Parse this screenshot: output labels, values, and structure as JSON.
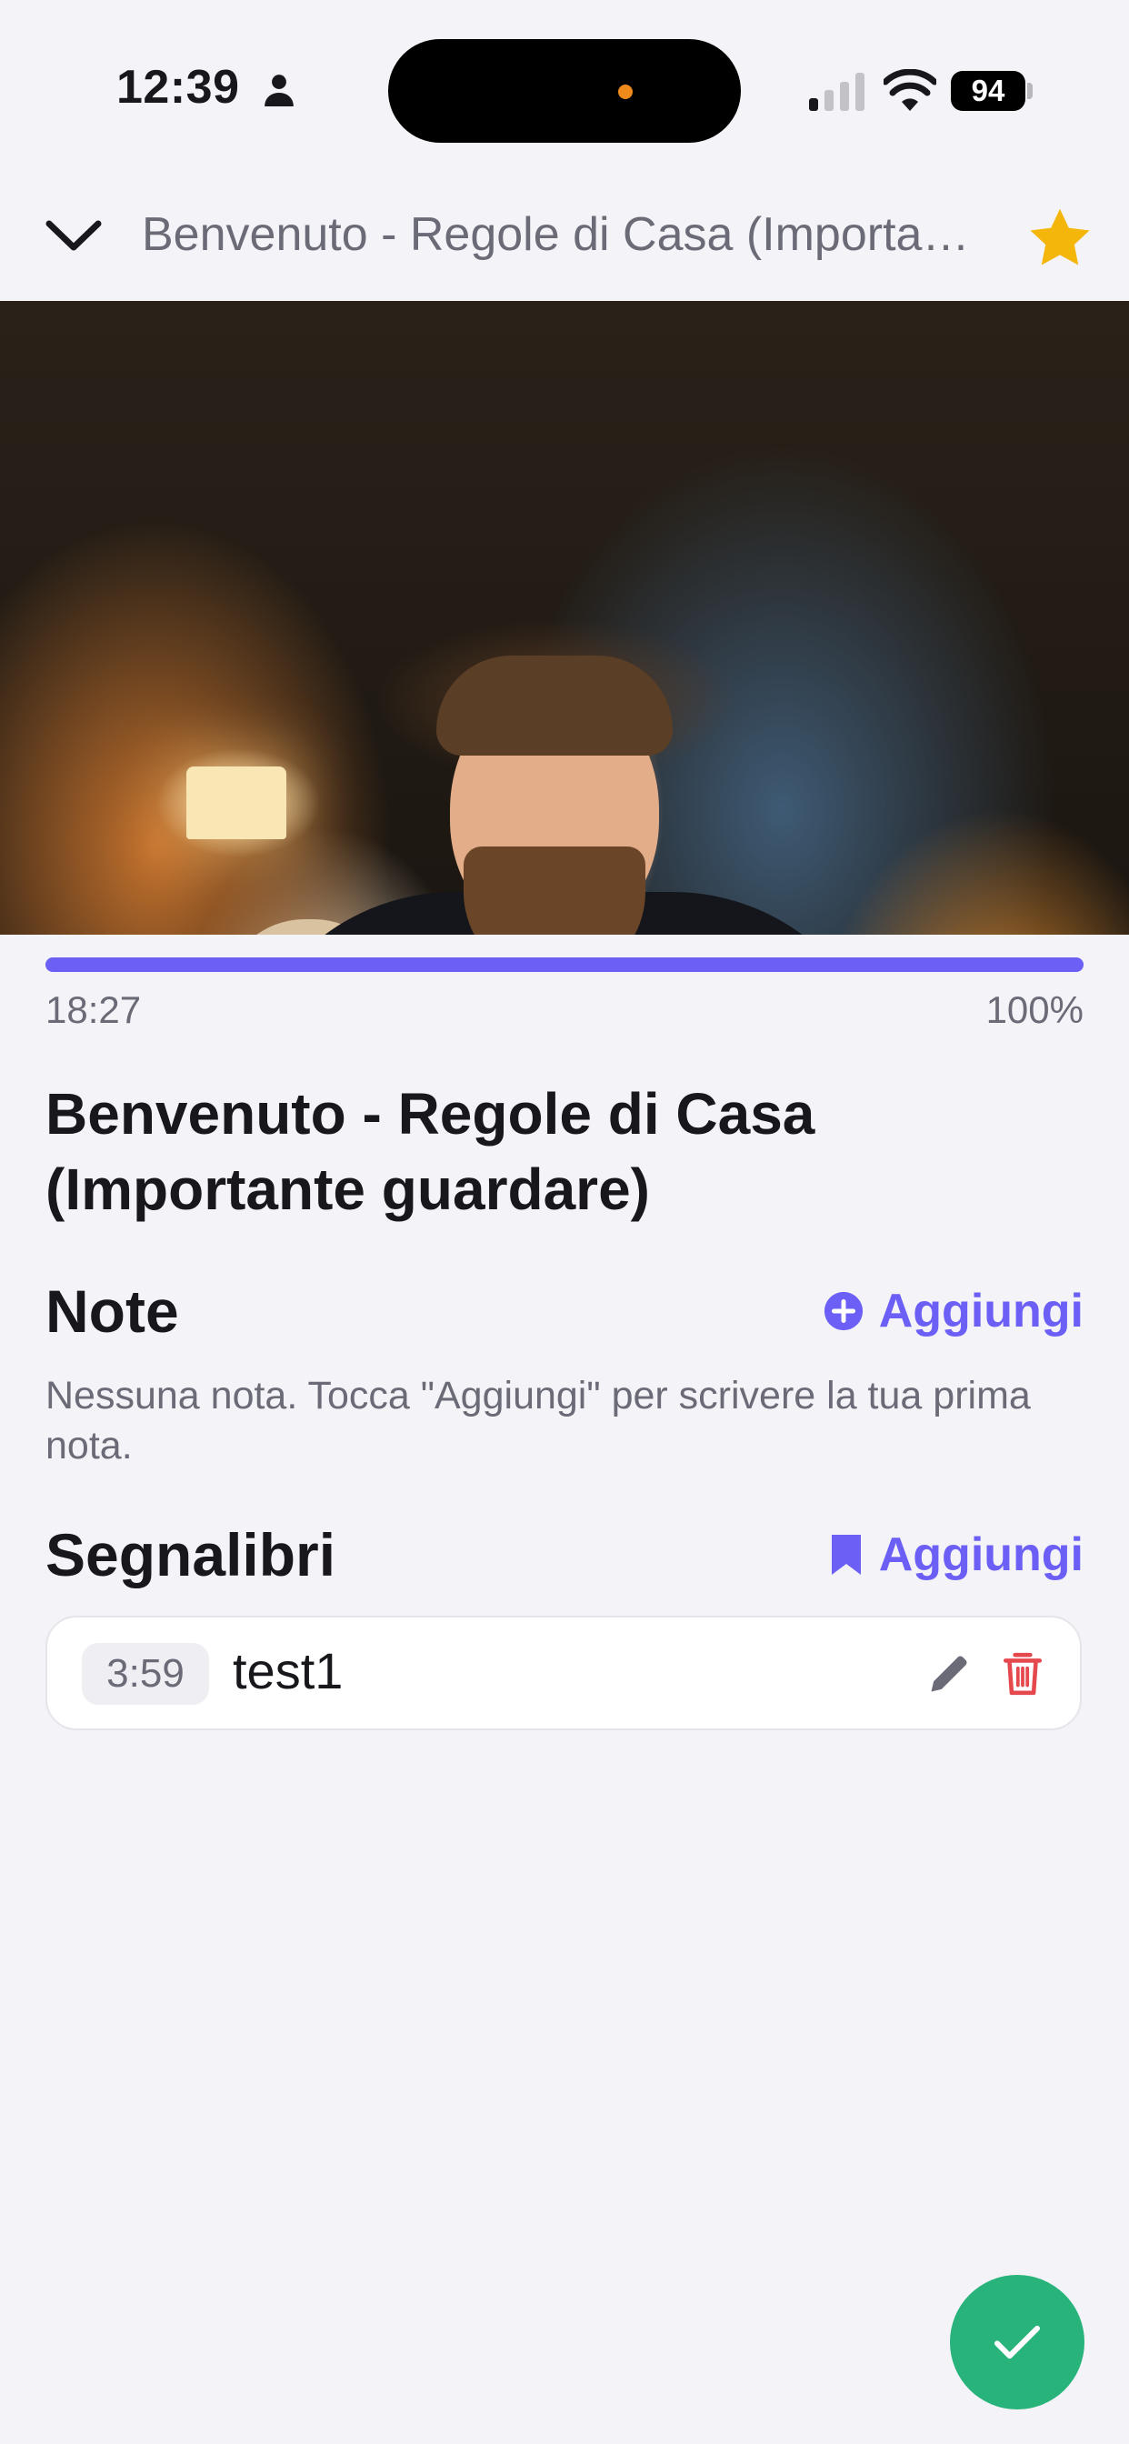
{
  "status_bar": {
    "time": "12:39",
    "battery": "94"
  },
  "header": {
    "title": "Benvenuto - Regole di Casa (Importante guardare)"
  },
  "player": {
    "time": "18:27",
    "percent": "100%",
    "progress": 1.0
  },
  "video_title": "Benvenuto - Regole di Casa (Importante guardare)",
  "notes": {
    "title": "Note",
    "add_label": "Aggiungi",
    "empty_text": "Nessuna nota. Tocca \"Aggiungi\" per scrivere la tua prima nota."
  },
  "bookmarks": {
    "title": "Segnalibri",
    "add_label": "Aggiungi",
    "items": [
      {
        "time": "3:59",
        "label": "test1"
      }
    ]
  },
  "colors": {
    "accent": "#6c5ff6",
    "star": "#f5b60c",
    "delete": "#e5484d",
    "done": "#27b37a"
  }
}
